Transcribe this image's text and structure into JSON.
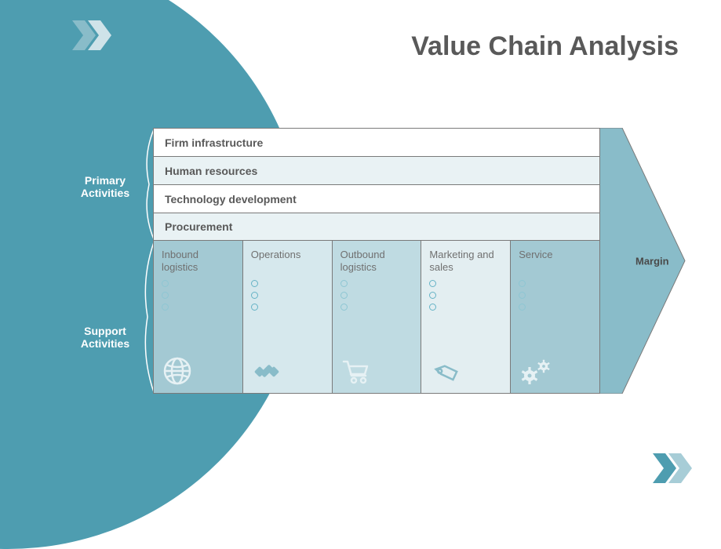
{
  "title": "Value Chain Analysis",
  "sideLabels": {
    "primary": "Primary\nActivities",
    "support": "Support\nActivities"
  },
  "supportActivities": [
    {
      "label": "Firm infrastructure"
    },
    {
      "label": "Human resources"
    },
    {
      "label": "Technology development"
    },
    {
      "label": "Procurement"
    }
  ],
  "primaryActivities": [
    {
      "label": "Inbound logistics",
      "icon": "globe-icon"
    },
    {
      "label": "Operations",
      "icon": "satellite-icon"
    },
    {
      "label": "Outbound logistics",
      "icon": "cart-icon"
    },
    {
      "label": "Marketing and sales",
      "icon": "tag-icon"
    },
    {
      "label": "Service",
      "icon": "gears-icon"
    }
  ],
  "marginLabel": "Margin",
  "colors": {
    "teal": "#4e9db0",
    "tealLight": "#89bcc9",
    "rowAlt": "#e9f2f4",
    "textGray": "#595959"
  }
}
